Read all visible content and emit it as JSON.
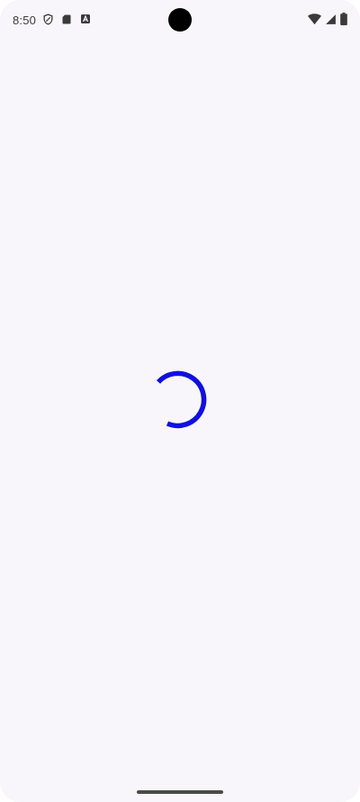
{
  "status_bar": {
    "time": "8:50",
    "left_icons": [
      "shield-icon",
      "sd-card-icon",
      "notification-a-icon"
    ],
    "right_icons": [
      "wifi-icon",
      "cell-signal-icon",
      "battery-icon"
    ]
  },
  "loading": {
    "indicator": "circular-progress",
    "color": "#1010e0"
  },
  "colors": {
    "background": "#f8f6fa",
    "spinner": "#1010e0",
    "status_icons": "#3a3a3a"
  }
}
